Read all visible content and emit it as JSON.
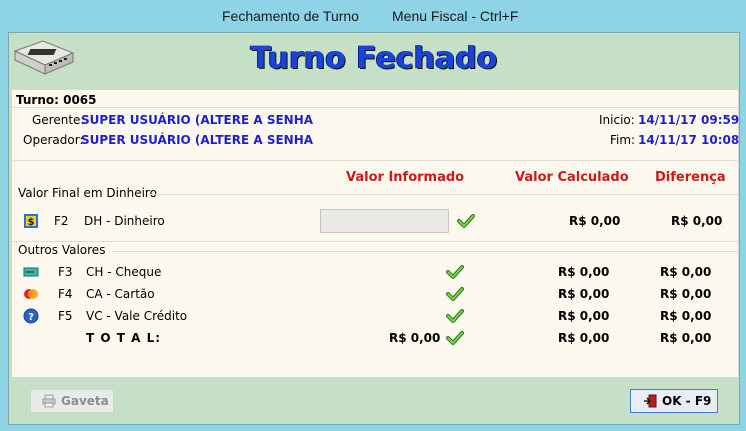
{
  "titlebar": {
    "title": "Fechamento de Turno",
    "menu": "Menu Fiscal - Ctrl+F"
  },
  "header": {
    "title": "Turno Fechado"
  },
  "info": {
    "turno": "Turno: 0065",
    "gerente_label": "Gerente:",
    "gerente_value": "SUPER USUÁRIO (ALTERE A SENHA",
    "operador_label": "Operador:",
    "operador_value": "SUPER USUÁRIO (ALTERE A SENHA",
    "inicio_label": "Inicio:",
    "inicio_value": "14/11/17 09:59",
    "fim_label": "Fim:",
    "fim_value": "14/11/17 10:08"
  },
  "columns": {
    "informado": "Valor Informado",
    "calculado": "Valor Calculado",
    "diferenca": "Diferença"
  },
  "dinheiro_section": {
    "title": "Valor Final em Dinheiro",
    "row": {
      "key": "F2",
      "label": "DH - Dinheiro",
      "informado": "",
      "calculado": "R$ 0,00",
      "diferenca": "R$ 0,00"
    }
  },
  "outros_section": {
    "title": "Outros Valores",
    "rows": [
      {
        "key": "F3",
        "label": "CH - Cheque",
        "calculado": "R$ 0,00",
        "diferenca": "R$ 0,00",
        "icon": "cheque-icon"
      },
      {
        "key": "F4",
        "label": "CA - Cartão",
        "calculado": "R$ 0,00",
        "diferenca": "R$ 0,00",
        "icon": "card-icon"
      },
      {
        "key": "F5",
        "label": "VC - Vale Crédito",
        "calculado": "R$ 0,00",
        "diferenca": "R$ 0,00",
        "icon": "help-icon"
      }
    ],
    "total": {
      "label": "T O T A L:",
      "informado": "R$ 0,00",
      "calculado": "R$ 0,00",
      "diferenca": "R$ 0,00"
    }
  },
  "footer": {
    "gaveta_label": "Gaveta",
    "ok_label": "OK - F9"
  }
}
